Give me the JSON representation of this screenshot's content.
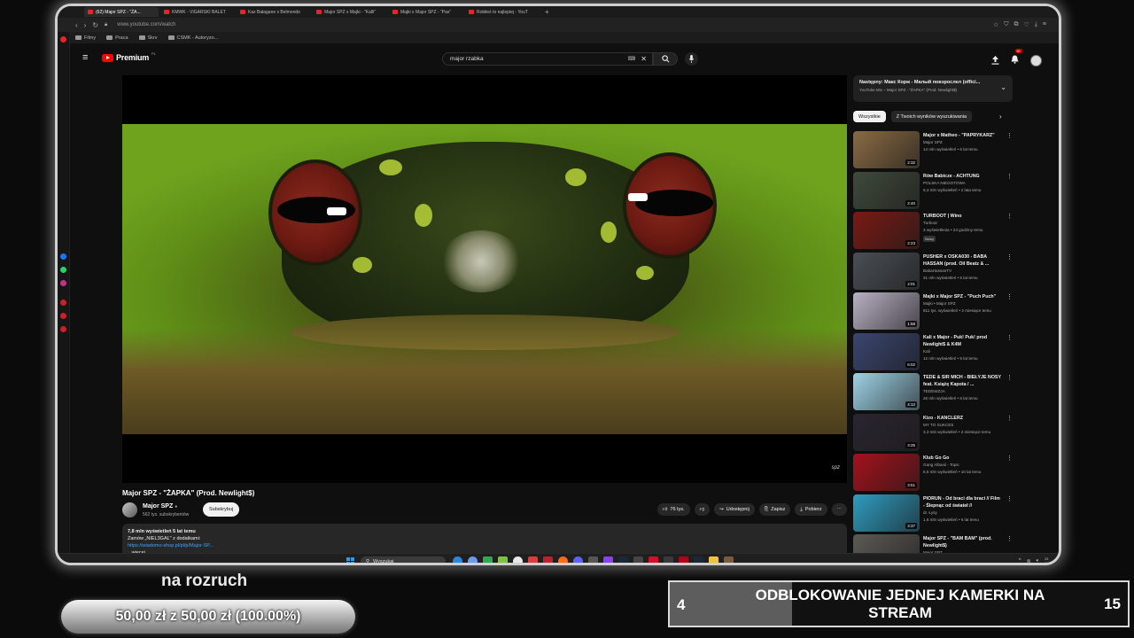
{
  "browser": {
    "tabs": [
      {
        "label": "(62) Major SPZ - \"ŻA...",
        "active": true
      },
      {
        "label": "KMWK - VIGARSKI BALET",
        "active": false
      },
      {
        "label": "Kaz Bałagane x Belmondo",
        "active": false
      },
      {
        "label": "Major SPZ x Majki - \"Kalli\"",
        "active": false
      },
      {
        "label": "Majki x Major SPZ - \"Pas\"",
        "active": false
      },
      {
        "label": "Robiłeś to najlepiej - YouT",
        "active": false
      }
    ],
    "url": "www.youtube.com/watch",
    "bookmarks": [
      "Filmy",
      "Praca",
      "Skrv",
      "CSMK - Autoryzo..."
    ]
  },
  "youtube": {
    "logo_text": "Premium",
    "logo_country": "PL",
    "search_value": "major rzabka",
    "notification_badge": "9+",
    "video": {
      "title": "Major SPZ - \"ŻAPKA\" (Prod. Newlight$)",
      "watermark": "spz",
      "channel": "Major SPZ",
      "subscribers": "562 tys. subskrybentów",
      "subscribe_label": "Subskrybuj",
      "likes": "76 tys.",
      "share_label": "Udostępnij",
      "save_label": "Zapisz",
      "download_label": "Pobierz"
    },
    "description": {
      "meta": "7,8 mln wyświetleń  5 lat temu",
      "line1": "Zamów „NIEL3GAL\" z dodatkami:",
      "link": "https://wiadomo-shop.pl/pl/p/Major-SP...",
      "line3": "...więcej"
    },
    "up_next": {
      "title": "Następny: Макс Корж - Малый повзрослел (offici...",
      "subtitle": "YouTube Mix – Major SPZ - \"ŻAPKA\" (Prod. Newlight$)"
    },
    "chips": [
      "Wszystkie",
      "Z Twoich wyników wyszukiwania"
    ],
    "recommendations": [
      {
        "title": "Major x Matheo - \"PAPRYKARZ\"",
        "channel": "Major SPZ",
        "meta": "14 mln wyświetleń • 6 lat temu",
        "duration": "2:32",
        "color": "#8a6b44",
        "new": ""
      },
      {
        "title": "Rów Babicze - ACHTUNG",
        "channel": "POLSKA NIEGOTOWA",
        "meta": "6,3 mln wyświetleń • 2 lata temu",
        "duration": "2:40",
        "color": "#3f4a3b",
        "new": ""
      },
      {
        "title": "TURBOOT | Wino",
        "channel": "Turboot",
        "meta": "3 wyświetlenia • 23 godziny temu",
        "duration": "2:23",
        "color": "#7a1a14",
        "new": "Nowy"
      },
      {
        "title": "PUSHER x OSKA030 - BABA HASSAN (prod. Oil Beatz & ...",
        "channel": "BabaHassanTV",
        "meta": "31 mln wyświetleń • 5 lat temu",
        "duration": "2:01",
        "color": "#4a4f55",
        "new": ""
      },
      {
        "title": "Majki x Major SPZ - \"Puch Puch\"",
        "channel": "Majki • Major SPZ",
        "meta": "811 tys. wyświetleń • 2 miesiące temu",
        "duration": "1:58",
        "color": "#b9b1c4",
        "new": ""
      },
      {
        "title": "Kali x Major - Puk! Puk! prod Newlight$ & K4M",
        "channel": "Kali",
        "meta": "12 mln wyświetleń • 5 lat temu",
        "duration": "6:02",
        "color": "#3a4670",
        "new": ""
      },
      {
        "title": "TEDE & SIR MICH - BIEŁYJE NOSY feat. Książę Kapota / ...",
        "channel": "TEDEWZJA",
        "meta": "26 mln wyświetleń • 6 lat temu",
        "duration": "4:12",
        "color": "#9fd3e6",
        "new": ""
      },
      {
        "title": "Kizo - KANCLERZ",
        "channel": "MY TO SUKCES",
        "meta": "3,3 mln wyświetleń • 2 miesiące temu",
        "duration": "3:25",
        "color": "#2a2530",
        "new": ""
      },
      {
        "title": "Klub Go Go",
        "channel": "Gang Albanii - Topic",
        "meta": "6,5 mln wyświetleń • 10 lat temu",
        "duration": "3:51",
        "color": "#a4121c",
        "new": ""
      },
      {
        "title": "PIORUN - Od braci dla braci // Film - Ślepnąc od świateł //",
        "channel": "dr. Łysy",
        "meta": "1,8 mln wyświetleń • 6 lat temu",
        "duration": "3:37",
        "color": "#2f9cc0",
        "new": ""
      },
      {
        "title": "Major SPZ - \"BAM BAM\" (prod. Newlight$)",
        "channel": "Major SPZ",
        "meta": "",
        "duration": "",
        "color": "#5d5a55",
        "new": ""
      }
    ]
  },
  "taskbar": {
    "search_placeholder": "Wyszukaj",
    "time": "21",
    "date": "17.0"
  },
  "overlay": {
    "goal_label": "na rozruch",
    "goal_text": "50,00 zł z 50,00 zł (100.00%)",
    "goal_progress": 1.0,
    "sub_goal_current": "4",
    "sub_goal_text": "ODBLOKOWANIE JEDNEJ KAMERKI NA STREAM",
    "sub_goal_max": "15",
    "sub_goal_progress": 0.2667
  },
  "colors": {
    "yt_bg": "#0f0f0f",
    "accent_red": "#ff0000",
    "link_blue": "#3ea6ff"
  }
}
